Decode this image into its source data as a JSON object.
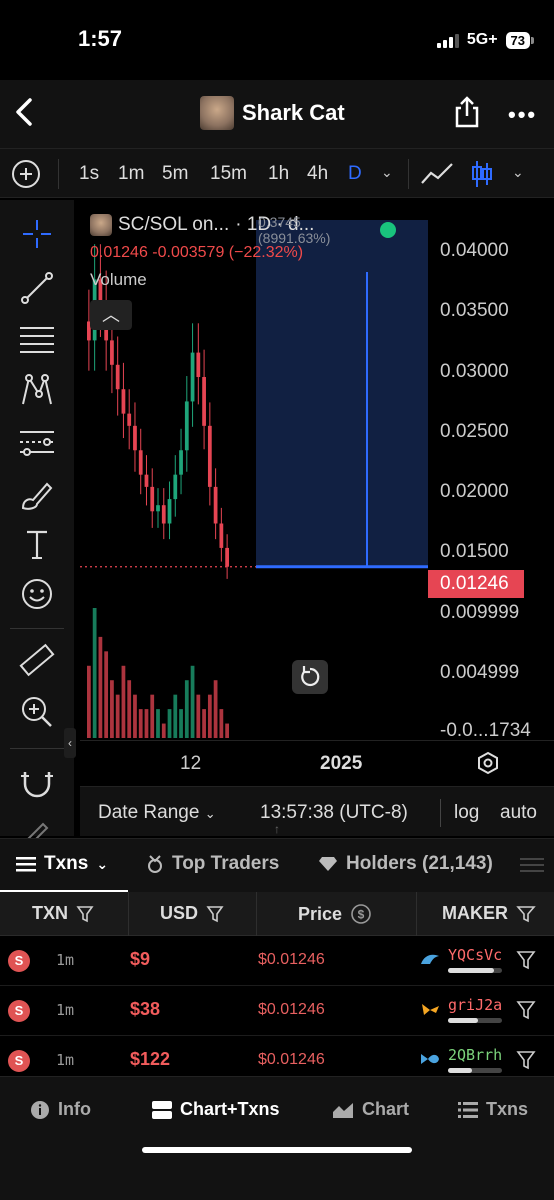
{
  "status_bar": {
    "time": "1:57",
    "network": "5G+",
    "battery": "73"
  },
  "header": {
    "title": "Shark Cat"
  },
  "timeframes": {
    "items": [
      "1s",
      "1m",
      "5m",
      "15m",
      "1h",
      "4h",
      "D"
    ],
    "active": "D"
  },
  "chart": {
    "pair_label": "SC/SOL on...",
    "interval_label": "· 1D · d...",
    "faint_label": "0.3745 (8991.63%)",
    "ohlc": "0.01246  -0.003579 (−22.32%)",
    "volume_label": "Volume",
    "current_price_tag": "0.01246",
    "y_ticks": [
      "0.04000",
      "0.03500",
      "0.03000",
      "0.02500",
      "0.02000",
      "0.01500",
      "0.009999",
      "0.004999",
      "-0.0...1734"
    ],
    "x_ticks": [
      "12",
      "2025"
    ],
    "accent_color": "#2f6bff",
    "down_color": "#e64553",
    "up_color": "#1fa57a"
  },
  "chart_data": {
    "type": "bar",
    "title": "SC/SOL",
    "xlabel": "",
    "ylabel": "",
    "ylim": [
      -0.001734,
      0.0425
    ],
    "x_ticks": [
      "12",
      "2025"
    ],
    "last_price": 0.01246,
    "change": -0.003579,
    "change_pct": -22.32,
    "series": [
      {
        "name": "Price",
        "values": [
          0.031,
          0.036,
          0.034,
          0.031,
          0.029,
          0.027,
          0.025,
          0.024,
          0.022,
          0.02,
          0.019,
          0.017,
          0.0175,
          0.016,
          0.018,
          0.02,
          0.022,
          0.026,
          0.03,
          0.028,
          0.024,
          0.019,
          0.016,
          0.014,
          0.01246
        ]
      },
      {
        "name": "Volume",
        "values": [
          5,
          9,
          7,
          6,
          4,
          3,
          5,
          4,
          3,
          2,
          2,
          3,
          2,
          1,
          2,
          3,
          2,
          4,
          5,
          3,
          2,
          3,
          4,
          2,
          1
        ]
      }
    ]
  },
  "date_bar": {
    "date_range": "Date Range",
    "clock": "13:57:38 (UTC-8)",
    "log": "log",
    "auto": "auto"
  },
  "tabs": [
    {
      "label": "Txns",
      "icon": "list-icon"
    },
    {
      "label": "Top Traders",
      "icon": "trophy-icon"
    },
    {
      "label": "Holders (21,143)",
      "icon": "diamond-icon"
    }
  ],
  "table": {
    "headers": [
      "TXN",
      "USD",
      "Price",
      "MAKER"
    ],
    "rows": [
      {
        "type": "S",
        "age": "1m",
        "usd": "$9",
        "price": "$0.01246",
        "maker": "YQCsVc",
        "maker_color": "#ff6b6b",
        "bar": 0.85,
        "icon_color": "#4aa3df"
      },
      {
        "type": "S",
        "age": "1m",
        "usd": "$38",
        "price": "$0.01246",
        "maker": "griJ2a",
        "maker_color": "#ff6b6b",
        "bar": 0.55,
        "icon_color": "#f5a623"
      },
      {
        "type": "S",
        "age": "1m",
        "usd": "$122",
        "price": "$0.01246",
        "maker": "2QBrrh",
        "maker_color": "#7cd57c",
        "bar": 0.45,
        "icon_color": "#4aa3df"
      }
    ]
  },
  "bottom_nav": [
    {
      "label": "Info",
      "icon": "info-icon"
    },
    {
      "label": "Chart+Txns",
      "icon": "split-icon"
    },
    {
      "label": "Chart",
      "icon": "chart-icon"
    },
    {
      "label": "Txns",
      "icon": "list-icon"
    }
  ]
}
